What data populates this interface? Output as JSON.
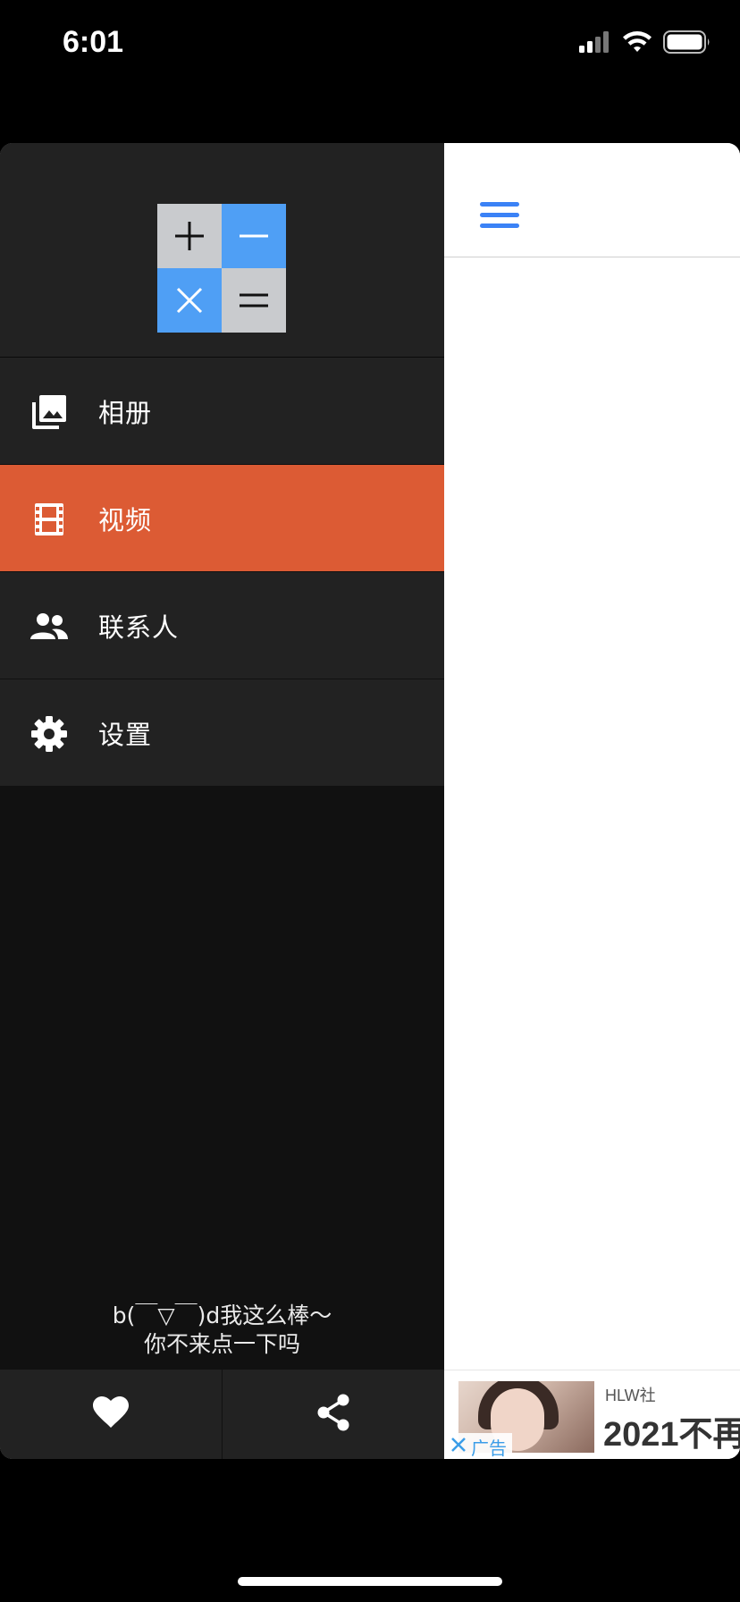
{
  "status_bar": {
    "time": "6:01",
    "icons": [
      "cellular-signal-icon",
      "wifi-icon",
      "battery-icon"
    ]
  },
  "logo": {
    "cells": [
      "plus",
      "minus",
      "times",
      "equals"
    ],
    "colors": {
      "gray": "#c9cbce",
      "blue": "#4f9ff5"
    }
  },
  "drawer": {
    "menu": [
      {
        "label": "相册",
        "icon": "photo-album-icon",
        "active": false
      },
      {
        "label": "视频",
        "icon": "film-icon",
        "active": true
      },
      {
        "label": "联系人",
        "icon": "people-icon",
        "active": false
      },
      {
        "label": "设置",
        "icon": "gear-icon",
        "active": false
      }
    ],
    "caption_line1": "b(￣▽￣)d我这么棒～",
    "caption_line2": "你不来点一下吗",
    "footer": [
      "heart-icon",
      "share-icon"
    ],
    "active_color": "#dc5b34"
  },
  "main": {
    "menu_icon": "hamburger-menu-icon",
    "accent": "#3b82f6"
  },
  "ad": {
    "tag": "广告",
    "source": "HLW社",
    "title": "2021不再"
  }
}
